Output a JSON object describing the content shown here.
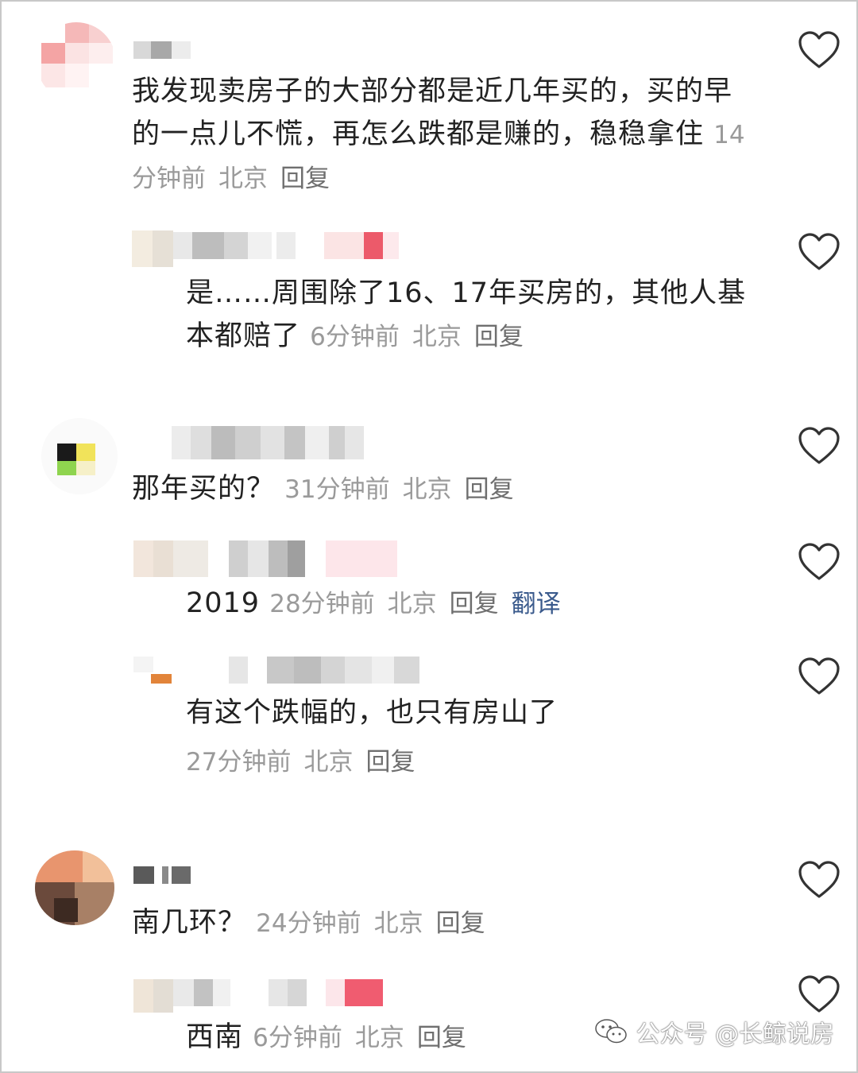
{
  "comments": [
    {
      "text": "我发现卖房子的大部分都是近几年买的，买的早的一点儿不慌，再怎么跌都是赚的，稳稳拿住",
      "time": "14分钟前",
      "location": "北京",
      "reply_label": "回复",
      "replies": [
        {
          "text": "是……周围除了16、17年买房的，其他人基本都赔了",
          "time": "6分钟前",
          "location": "北京",
          "reply_label": "回复"
        }
      ]
    },
    {
      "text": "那年买的？",
      "time": "31分钟前",
      "location": "北京",
      "reply_label": "回复",
      "replies": [
        {
          "text": "2019",
          "time": "28分钟前",
          "location": "北京",
          "reply_label": "回复",
          "translate_label": "翻译"
        },
        {
          "text": "有这个跌幅的，也只有房山了",
          "time": "27分钟前",
          "location": "北京",
          "reply_label": "回复"
        }
      ]
    },
    {
      "text": "南几环？",
      "time": "24分钟前",
      "location": "北京",
      "reply_label": "回复",
      "replies": [
        {
          "text": "西南",
          "time": "6分钟前",
          "location": "北京",
          "reply_label": "回复"
        }
      ]
    }
  ],
  "watermark": {
    "text": "公众号 @长鲸说房",
    "icon": "wechat-icon"
  },
  "icons": {
    "like": "heart-outline-icon"
  },
  "colors": {
    "text": "#222222",
    "meta": "#9a9a9a",
    "translate": "#3a5a8c",
    "heart_stroke": "#333333"
  }
}
